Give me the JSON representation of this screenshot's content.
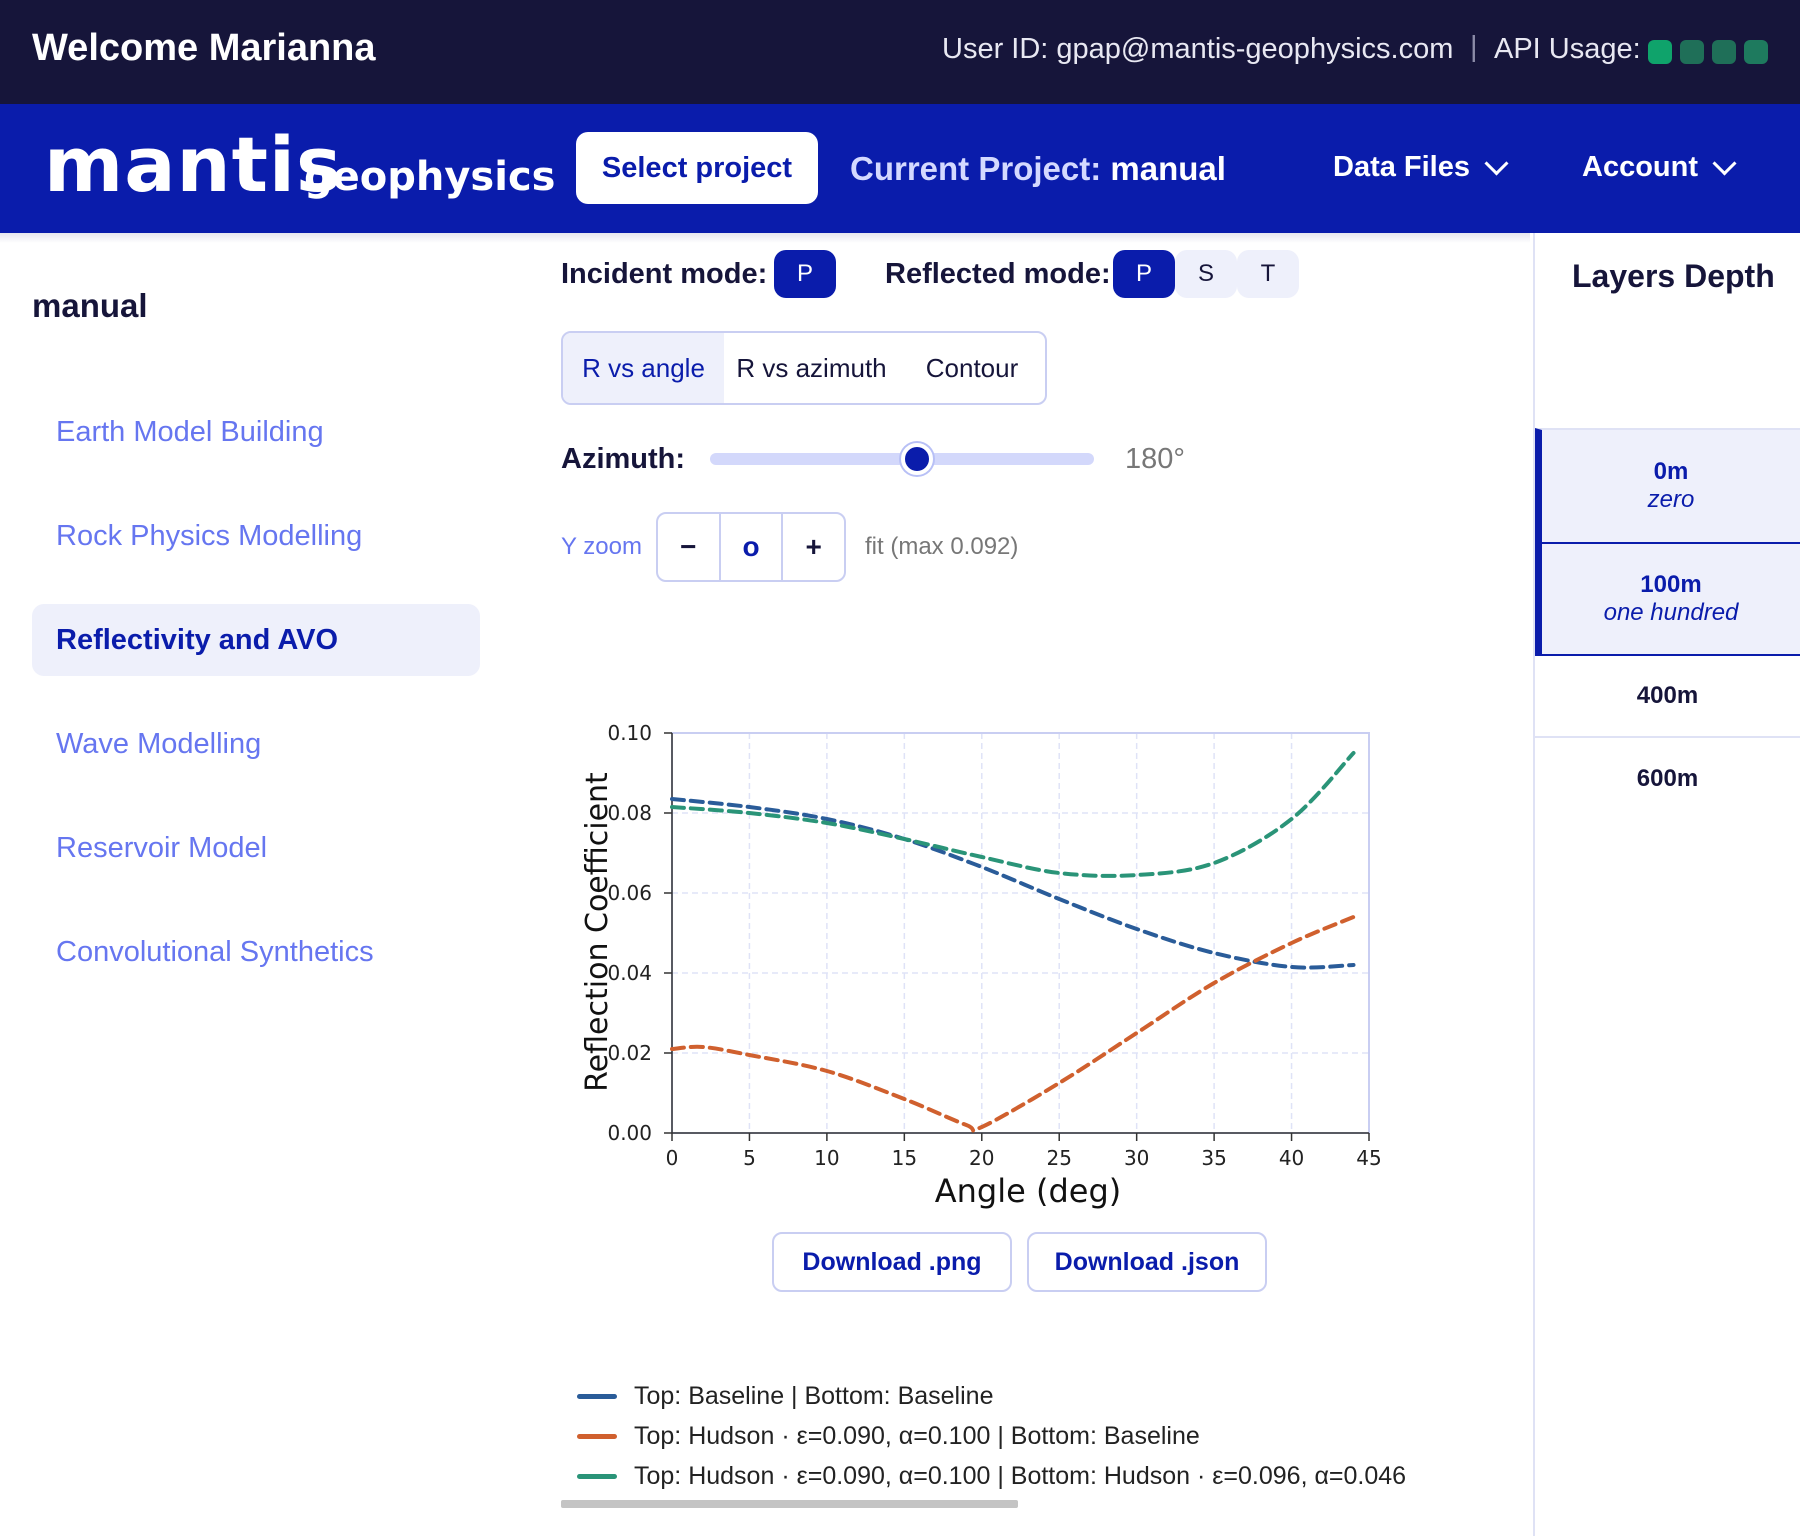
{
  "topbar": {
    "welcome": "Welcome Marianna",
    "user_id": "User ID: gpap@mantis-geophysics.com",
    "separator": "|",
    "api_usage_label": "API Usage:",
    "api_usage_colors": [
      "#0fa36b",
      "#1f6f58",
      "#1f6f58",
      "#1e7a5e"
    ]
  },
  "navbar": {
    "logo_main": "mantis",
    "logo_sub": "geophysics",
    "select_project": "Select project",
    "current_project_label": "Current Project:",
    "current_project_name": "manual",
    "data_files": "Data Files",
    "account": "Account"
  },
  "sidebar": {
    "project": "manual",
    "items": [
      {
        "label": "Earth Model Building"
      },
      {
        "label": "Rock Physics Modelling"
      },
      {
        "label": "Reflectivity and AVO"
      },
      {
        "label": "Wave Modelling"
      },
      {
        "label": "Reservoir Model"
      },
      {
        "label": "Convolutional Synthetics"
      }
    ],
    "active_index": 2
  },
  "controls": {
    "incident_label": "Incident mode:",
    "incident_modes": [
      "P"
    ],
    "reflected_label": "Reflected mode:",
    "reflected_modes": [
      "P",
      "S",
      "T"
    ],
    "reflected_selected": "P",
    "view_tabs": [
      "R vs angle",
      "R vs azimuth",
      "Contour"
    ],
    "view_selected": "R vs angle",
    "azimuth_label": "Azimuth:",
    "azimuth_value": "180°",
    "azimuth_fraction": 0.54,
    "yzoom_label": "Y zoom",
    "zoom_minus": "−",
    "zoom_reset": "o",
    "zoom_plus": "+",
    "fit_label": "fit (max 0.092)"
  },
  "chart_data": {
    "type": "line",
    "xlabel": "Angle (deg)",
    "ylabel": "Reflection Coefficient",
    "xlim": [
      0,
      45
    ],
    "ylim": [
      0,
      0.1
    ],
    "xticks": [
      0,
      5,
      10,
      15,
      20,
      25,
      30,
      35,
      40,
      45
    ],
    "yticks": [
      0.0,
      0.02,
      0.04,
      0.06,
      0.08,
      0.1
    ],
    "grid": true,
    "line_style": "dashed",
    "series": [
      {
        "name": "Top: Baseline | Bottom: Baseline",
        "color": "#2a5c99",
        "x": [
          0,
          5,
          10,
          15,
          20,
          25,
          30,
          35,
          40,
          44
        ],
        "y": [
          0.0835,
          0.0815,
          0.0785,
          0.0735,
          0.0665,
          0.0585,
          0.051,
          0.045,
          0.0415,
          0.042
        ]
      },
      {
        "name": "Top: Hudson · ε=0.090, α=0.100 | Bottom: Baseline",
        "color": "#d0602e",
        "x": [
          0,
          2,
          5,
          10,
          15,
          19,
          20,
          25,
          30,
          35,
          40,
          44
        ],
        "y": [
          0.021,
          0.0215,
          0.0195,
          0.0155,
          0.0085,
          0.002,
          0.0015,
          0.0125,
          0.025,
          0.0375,
          0.0475,
          0.054
        ]
      },
      {
        "name": "Top: Hudson · ε=0.090, α=0.100 | Bottom: Hudson · ε=0.096, α=0.046",
        "color": "#2a9478",
        "x": [
          0,
          5,
          10,
          15,
          20,
          25,
          30,
          35,
          40,
          44
        ],
        "y": [
          0.0815,
          0.08,
          0.0775,
          0.0735,
          0.069,
          0.065,
          0.0645,
          0.0675,
          0.0785,
          0.095
        ]
      }
    ]
  },
  "downloads": {
    "png": "Download .png",
    "json": "Download .json"
  },
  "layers": {
    "title": "Layers Depth",
    "items": [
      {
        "depth": "0m",
        "name": "zero",
        "selected": true
      },
      {
        "depth": "100m",
        "name": "one hundred",
        "selected": true
      },
      {
        "depth": "400m",
        "name": "",
        "selected": false
      },
      {
        "depth": "600m",
        "name": "",
        "selected": false
      }
    ]
  }
}
